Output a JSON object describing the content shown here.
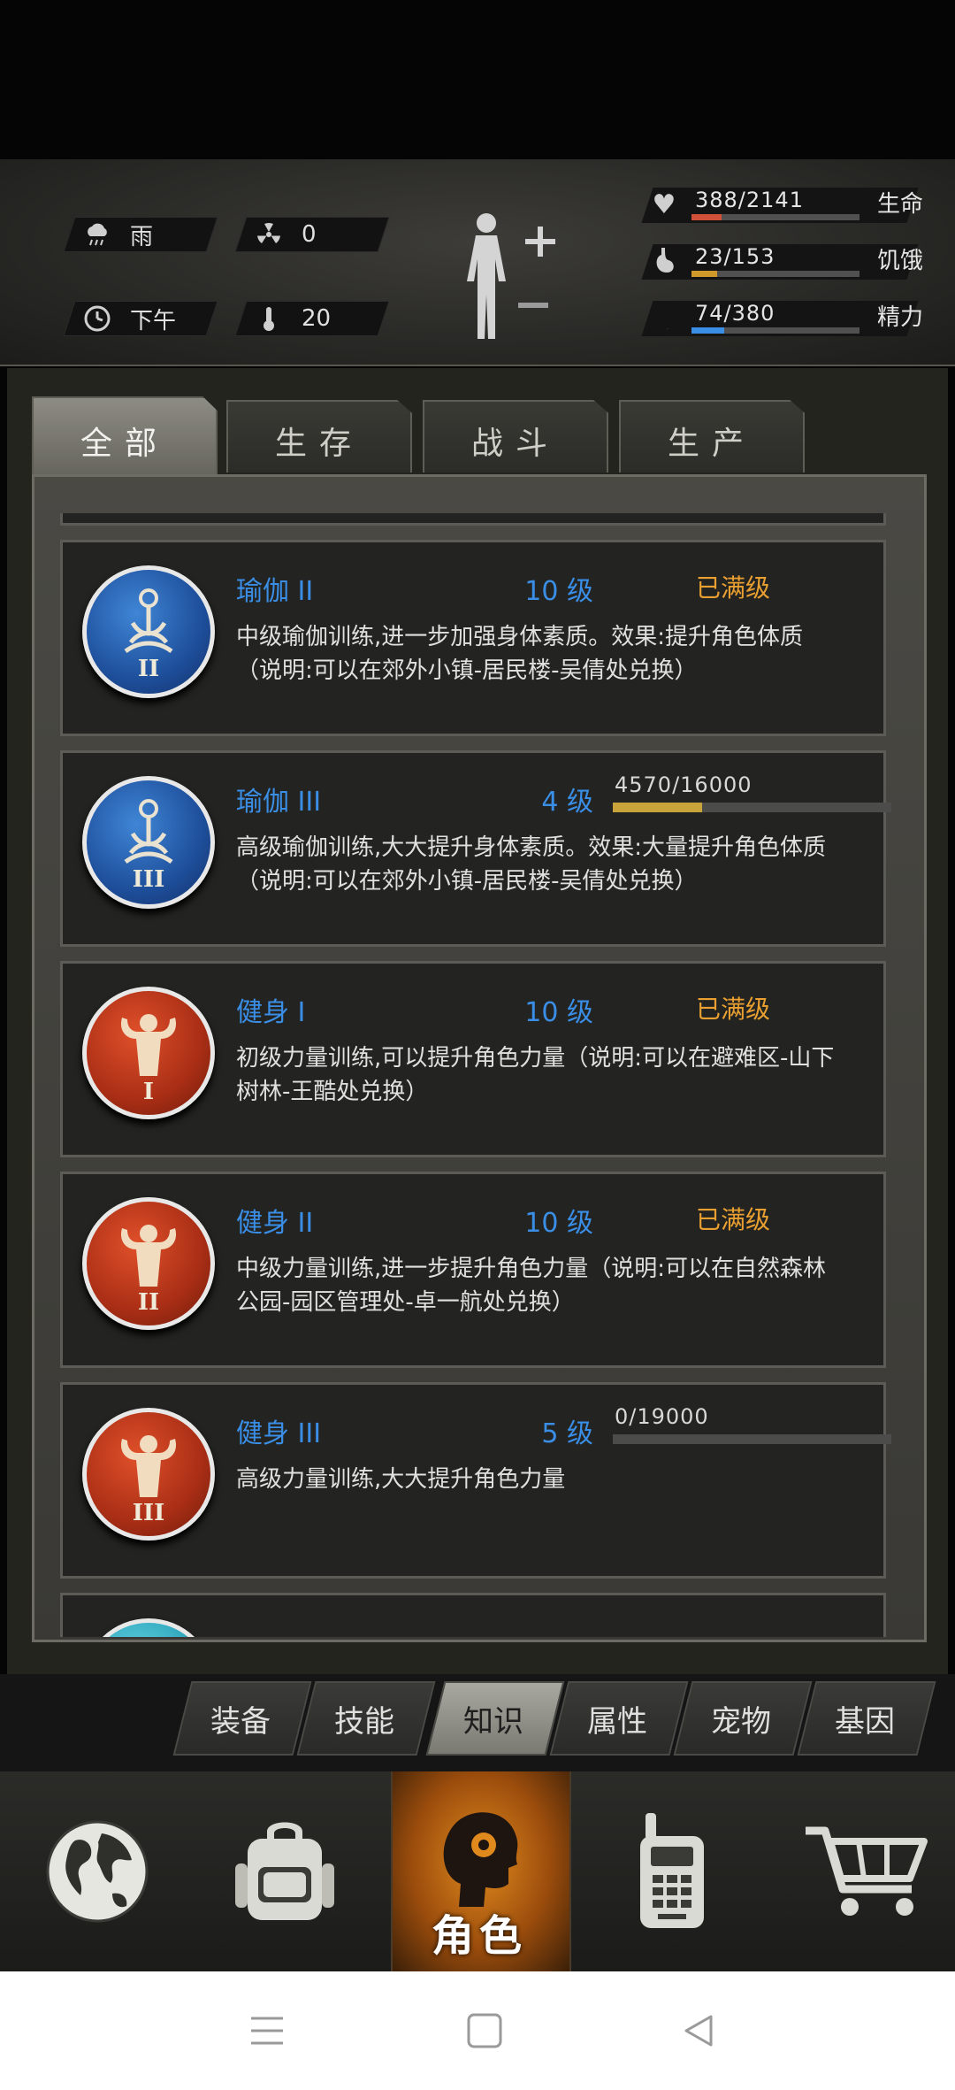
{
  "hud": {
    "weather_label": "雨",
    "radiation_value": "0",
    "time_label": "下午",
    "temperature_value": "20",
    "stats": [
      {
        "value": "388/2141",
        "label": "生命",
        "fill": 0.181,
        "color": "#d0503a",
        "icon": "heart-icon"
      },
      {
        "value": "23/153",
        "label": "饥饿",
        "fill": 0.15,
        "color": "#d09a2a",
        "icon": "stomach-icon"
      },
      {
        "value": "74/380",
        "label": "精力",
        "fill": 0.195,
        "color": "#3a8ee6",
        "icon": "energy-icon"
      }
    ]
  },
  "tabs": [
    {
      "label": "全部",
      "active": true
    },
    {
      "label": "生存",
      "active": false
    },
    {
      "label": "战斗",
      "active": false
    },
    {
      "label": "生产",
      "active": false
    }
  ],
  "skills": [
    {
      "title": "瑜伽 II",
      "level": "10 级",
      "max_label": "已满级",
      "desc": "中级瑜伽训练,进一步加强身体素质。效果:提升角色体质（说明:可以在郊外小镇-居民楼-吴倩处兑换）",
      "icon": "yoga-icon",
      "numeral": "II",
      "color": "blue"
    },
    {
      "title": "瑜伽 III",
      "level": "4 级",
      "progress_text": "4570/16000",
      "progress": 0.2856,
      "desc": "高级瑜伽训练,大大提升身体素质。效果:大量提升角色体质（说明:可以在郊外小镇-居民楼-吴倩处兑换）",
      "icon": "yoga-icon",
      "numeral": "III",
      "color": "blue"
    },
    {
      "title": "健身 I",
      "level": "10 级",
      "max_label": "已满级",
      "desc": "初级力量训练,可以提升角色力量（说明:可以在避难区-山下树林-王酷处兑换）",
      "icon": "bodybuilder-icon",
      "numeral": "I",
      "color": "red"
    },
    {
      "title": "健身 II",
      "level": "10 级",
      "max_label": "已满级",
      "desc": "中级力量训练,进一步提升角色力量（说明:可以在自然森林公园-园区管理处-卓一航处兑换）",
      "icon": "bodybuilder-icon",
      "numeral": "II",
      "color": "red"
    },
    {
      "title": "健身 III",
      "level": "5 级",
      "progress_text": "0/19000",
      "progress": 0,
      "desc": "高级力量训练,大大提升角色力量",
      "icon": "bodybuilder-icon",
      "numeral": "III",
      "color": "red"
    }
  ],
  "subtabs": [
    {
      "label": "装备",
      "active": false
    },
    {
      "label": "技能",
      "active": false
    },
    {
      "label": "知识",
      "active": true
    },
    {
      "label": "属性",
      "active": false
    },
    {
      "label": "宠物",
      "active": false
    },
    {
      "label": "基因",
      "active": false
    }
  ],
  "nav": {
    "role_label": "角色",
    "icons": [
      "globe-icon",
      "backpack-icon",
      "role-head-icon",
      "walkie-talkie-icon",
      "shopping-cart-icon"
    ]
  }
}
